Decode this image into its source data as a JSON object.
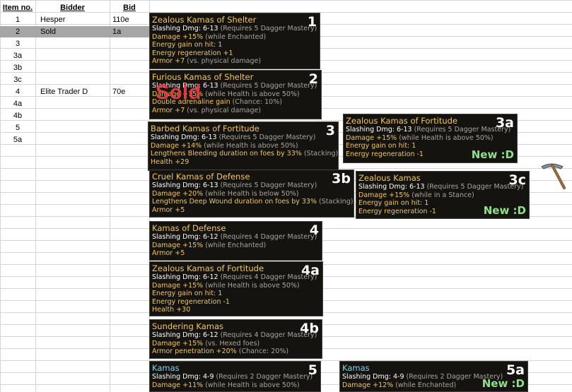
{
  "sheet": {
    "headers": {
      "item_no": "Item no.",
      "bidder": "Bidder",
      "bid": "Bid"
    },
    "rows": [
      {
        "item": "1",
        "bidder": "Hesper",
        "bid": "110e"
      },
      {
        "item": "2",
        "bidder": "Sold",
        "bid": "1a"
      },
      {
        "item": "3",
        "bidder": "",
        "bid": ""
      },
      {
        "item": "3a",
        "bidder": "",
        "bid": ""
      },
      {
        "item": "3b",
        "bidder": "",
        "bid": ""
      },
      {
        "item": "3c",
        "bidder": "",
        "bid": ""
      },
      {
        "item": "4",
        "bidder": "Elite Trader D",
        "bid": "70e"
      },
      {
        "item": "4a",
        "bidder": "",
        "bid": ""
      },
      {
        "item": "4b",
        "bidder": "",
        "bid": ""
      },
      {
        "item": "5",
        "bidder": "",
        "bid": ""
      },
      {
        "item": "5a",
        "bidder": "",
        "bid": ""
      }
    ]
  },
  "sold_stamp": "Sold",
  "new_label": "New :D",
  "tooltips": [
    {
      "id": "1",
      "name": "Zealous Kamas of Shelter",
      "name_color": "gold",
      "lines": [
        [
          "Slashing Dmg: 6-13 ",
          "(Requires 5 Dagger Mastery)"
        ],
        [
          "Damage +15% ",
          "(while Enchanted)"
        ],
        [
          "Energy gain on hit: 1",
          ""
        ],
        [
          "Energy regeneration +1",
          ""
        ],
        [
          "Armor +7 ",
          "(vs. physical damage)"
        ]
      ]
    },
    {
      "id": "2",
      "name": "Furious Kamas of Shelter",
      "name_color": "gold",
      "lines": [
        [
          "Slashing Dmg: 6-13 ",
          "(Requires 5 Dagger Mastery)"
        ],
        [
          "Damage +15% ",
          "(while Health is above 50%)"
        ],
        [
          "Double adrenaline gain ",
          "(Chance: 10%)"
        ],
        [
          "Armor +7 ",
          "(vs. physical damage)"
        ]
      ]
    },
    {
      "id": "3",
      "name": "Barbed Kamas of Fortitude",
      "name_color": "gold",
      "lines": [
        [
          "Slashing Dmg: 6-13 ",
          "(Requires 5 Dagger Mastery)"
        ],
        [
          "Damage +14% ",
          "(while Health is above 50%)"
        ],
        [
          "Lengthens Bleeding duration on foes by 33% ",
          "(Stacking)"
        ],
        [
          "Health +29",
          ""
        ]
      ]
    },
    {
      "id": "3a",
      "name": "Zealous Kamas of Fortitude",
      "name_color": "gold",
      "lines": [
        [
          "Slashing Dmg: 6-13 ",
          "(Requires 5 Dagger Mastery)"
        ],
        [
          "Damage +15% ",
          "(while Health is above 50%)"
        ],
        [
          "Energy gain on hit: 1",
          ""
        ],
        [
          "Energy regeneration -1",
          ""
        ]
      ]
    },
    {
      "id": "3b",
      "name": "Cruel Kamas of Defense",
      "name_color": "gold",
      "lines": [
        [
          "Slashing Dmg: 6-13 ",
          "(Requires 5 Dagger Mastery)"
        ],
        [
          "Damage +20% ",
          "(while Health is below 50%)"
        ],
        [
          "Lengthens Deep Wound duration on foes by 33% ",
          "(Stacking)"
        ],
        [
          "Armor +5",
          ""
        ]
      ]
    },
    {
      "id": "3c",
      "name": "Zealous Kamas",
      "name_color": "gold",
      "lines": [
        [
          "Slashing Dmg: 6-13 ",
          "(Requires 5 Dagger Mastery)"
        ],
        [
          "Damage +15% ",
          "(while in a Stance)"
        ],
        [
          "Energy gain on hit: 1",
          ""
        ],
        [
          "Energy regeneration -1",
          ""
        ]
      ]
    },
    {
      "id": "4",
      "name": "Kamas of Defense",
      "name_color": "gold",
      "lines": [
        [
          "Slashing Dmg: 6-12 ",
          "(Requires 4 Dagger Mastery)"
        ],
        [
          "Damage +15% ",
          "(while Enchanted)"
        ],
        [
          "Armor +5",
          ""
        ]
      ]
    },
    {
      "id": "4a",
      "name": "Zealous Kamas of Fortitude",
      "name_color": "gold",
      "lines": [
        [
          "Slashing Dmg: 6-12 ",
          "(Requires 4 Dagger Mastery)"
        ],
        [
          "Damage +15% ",
          "(while Health is above 50%)"
        ],
        [
          "Energy gain on hit: 1",
          ""
        ],
        [
          "Energy regeneration -1",
          ""
        ],
        [
          "Health +30",
          ""
        ]
      ]
    },
    {
      "id": "4b",
      "name": "Sundering Kamas",
      "name_color": "gold",
      "lines": [
        [
          "Slashing Dmg: 6-12 ",
          "(Requires 4 Dagger Mastery)"
        ],
        [
          "Damage +15% ",
          "(vs. Hexed foes)"
        ],
        [
          "Armor penetration +20% ",
          "(Chance: 20%)"
        ]
      ]
    },
    {
      "id": "5",
      "name": "Kamas",
      "name_color": "blue",
      "lines": [
        [
          "Slashing Dmg: 4-9 ",
          "(Requires 2 Dagger Mastery)"
        ],
        [
          "Damage +11% ",
          "(while Health is above 50%)"
        ]
      ]
    },
    {
      "id": "5a",
      "name": "Kamas",
      "name_color": "blue",
      "lines": [
        [
          "Slashing Dmg: 4-9 ",
          "(Requires 2 Dagger Mastery)"
        ],
        [
          "Damage +12% ",
          "(while Enchanted)"
        ]
      ]
    }
  ]
}
